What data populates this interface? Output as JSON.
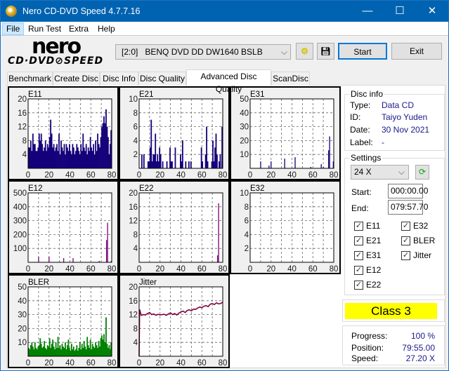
{
  "window": {
    "title": "Nero CD-DVD Speed 4.7.7.16",
    "minimize": "—",
    "maximize": "☐",
    "close": "✕"
  },
  "menu": [
    "File",
    "Run Test",
    "Extra",
    "Help"
  ],
  "logo": {
    "top": "nero",
    "bottom": "CD·DVD⊘SPEED"
  },
  "toolbar": {
    "drive": "[2:0]   BENQ DVD DD DW1640 BSLB",
    "start": "Start",
    "exit": "Exit"
  },
  "tabs": [
    "Benchmark",
    "Create Disc",
    "Disc Info",
    "Disc Quality",
    "Advanced Disc Quality",
    "ScanDisc"
  ],
  "active_tab": "Advanced Disc Quality",
  "disc_info": {
    "title": "Disc info",
    "type_label": "Type:",
    "type": "Data CD",
    "id_label": "ID:",
    "id": "Taiyo Yuden",
    "date_label": "Date:",
    "date": "30 Nov 2021",
    "label_label": "Label:",
    "label": "-"
  },
  "settings": {
    "title": "Settings",
    "speed": "24 X",
    "start_label": "Start:",
    "start": "000:00.00",
    "end_label": "End:",
    "end": "079:57.70",
    "checks": [
      {
        "label": "E11",
        "checked": true
      },
      {
        "label": "E32",
        "checked": true
      },
      {
        "label": "E21",
        "checked": true
      },
      {
        "label": "BLER",
        "checked": true
      },
      {
        "label": "E31",
        "checked": true
      },
      {
        "label": "Jitter",
        "checked": true
      },
      {
        "label": "E12",
        "checked": true
      },
      {
        "label": "E22",
        "checked": true
      }
    ]
  },
  "result": {
    "class": "Class 3",
    "color": "#ffff00"
  },
  "status": {
    "progress_label": "Progress:",
    "progress": "100 %",
    "position_label": "Position:",
    "position": "79:55.00",
    "speed_label": "Speed:",
    "speed": "27.20 X"
  },
  "chart_data": [
    {
      "title": "E11",
      "type": "bar",
      "color": "#14007a",
      "xlim": [
        0,
        80
      ],
      "ylim": [
        0,
        20
      ],
      "yticks": [
        4,
        8,
        12,
        16,
        20
      ],
      "xticks": [
        0,
        20,
        40,
        60,
        80
      ],
      "grid": true,
      "values": [
        6,
        6,
        8,
        5,
        10,
        7,
        7,
        5,
        5,
        6,
        10,
        8,
        10,
        7,
        5,
        6,
        8,
        5,
        7,
        6,
        9,
        14,
        10,
        6,
        7,
        5,
        6,
        7,
        5,
        10,
        4,
        8,
        6,
        5,
        7,
        4,
        7,
        6,
        5,
        7,
        5,
        4,
        7,
        6,
        4,
        5,
        7,
        6,
        5,
        4,
        7,
        5,
        10,
        6,
        5,
        7,
        4,
        6,
        5,
        9,
        6,
        5,
        7,
        4,
        8,
        5,
        10,
        7,
        6,
        9,
        12,
        13,
        15,
        13,
        17,
        12,
        9,
        4,
        7,
        6,
        11
      ]
    },
    {
      "title": "E21",
      "type": "bar",
      "color": "#14007a",
      "xlim": [
        0,
        80
      ],
      "ylim": [
        0,
        10
      ],
      "yticks": [
        2,
        4,
        6,
        8,
        10
      ],
      "xticks": [
        0,
        20,
        40,
        60,
        80
      ],
      "grid": true,
      "values": [
        0,
        0,
        2,
        0,
        2,
        0,
        0,
        0,
        1,
        1,
        3,
        7,
        1,
        2,
        2,
        5,
        1,
        2,
        1,
        3,
        2,
        0,
        1,
        0,
        0,
        0,
        1,
        0,
        0,
        3,
        1,
        1,
        0,
        0,
        3,
        0,
        0,
        0,
        0,
        2,
        1,
        4,
        0,
        0,
        1,
        0,
        0,
        1,
        0,
        1,
        0,
        0,
        0,
        0,
        0,
        0,
        0,
        0,
        0,
        3,
        1,
        0,
        0,
        2,
        6,
        1,
        0,
        0,
        0,
        1,
        4,
        1,
        3,
        5,
        2,
        0,
        1,
        2,
        0,
        1,
        6
      ]
    },
    {
      "title": "E31",
      "type": "bar",
      "color": "#14007a",
      "xlim": [
        0,
        80
      ],
      "ylim": [
        0,
        50
      ],
      "yticks": [
        10,
        20,
        30,
        40,
        50
      ],
      "xticks": [
        0,
        20,
        40,
        60,
        80
      ],
      "grid": true,
      "points": [
        [
          10,
          5
        ],
        [
          18,
          2
        ],
        [
          20,
          5
        ],
        [
          33,
          7
        ],
        [
          43,
          8
        ],
        [
          58,
          1
        ],
        [
          68,
          3
        ],
        [
          70,
          1
        ],
        [
          75,
          13
        ],
        [
          76,
          23
        ],
        [
          80,
          5
        ]
      ]
    },
    {
      "title": "E12",
      "type": "bar",
      "color": "#7a007a",
      "xlim": [
        0,
        80
      ],
      "ylim": [
        0,
        500
      ],
      "yticks": [
        100,
        200,
        300,
        400,
        500
      ],
      "xticks": [
        0,
        20,
        40,
        60,
        80
      ],
      "grid": true,
      "points": [
        [
          10,
          40
        ],
        [
          20,
          40
        ],
        [
          34,
          30
        ],
        [
          43,
          30
        ],
        [
          68,
          10
        ],
        [
          75,
          160
        ],
        [
          76,
          285
        ],
        [
          80,
          10
        ]
      ]
    },
    {
      "title": "E22",
      "type": "bar",
      "color": "#7a007a",
      "xlim": [
        0,
        80
      ],
      "ylim": [
        0,
        20
      ],
      "yticks": [
        4,
        8,
        12,
        16,
        20
      ],
      "xticks": [
        0,
        20,
        40,
        60,
        80
      ],
      "grid": true,
      "points": [
        [
          75,
          2
        ],
        [
          76,
          17
        ]
      ]
    },
    {
      "title": "E32",
      "type": "bar",
      "color": "#7a007a",
      "xlim": [
        0,
        80
      ],
      "ylim": [
        0,
        10
      ],
      "yticks": [
        2,
        4,
        6,
        8,
        10
      ],
      "xticks": [
        0,
        20,
        40,
        60,
        80
      ],
      "grid": true,
      "points": []
    },
    {
      "title": "BLER",
      "type": "bar",
      "color": "#008000",
      "xlim": [
        0,
        80
      ],
      "ylim": [
        0,
        50
      ],
      "yticks": [
        10,
        20,
        30,
        40,
        50
      ],
      "xticks": [
        0,
        20,
        40,
        60,
        80
      ],
      "grid": true,
      "values": [
        6,
        5,
        8,
        10,
        7,
        5,
        10,
        6,
        5,
        7,
        8,
        13,
        9,
        6,
        7,
        11,
        6,
        5,
        8,
        7,
        13,
        6,
        9,
        12,
        7,
        5,
        10,
        6,
        14,
        6,
        8,
        5,
        9,
        7,
        6,
        10,
        5,
        8,
        12,
        6,
        4,
        9,
        5,
        7,
        4,
        5,
        8,
        4,
        6,
        10,
        5,
        9,
        6,
        11,
        7,
        5,
        14,
        8,
        6,
        12,
        5,
        9,
        7,
        6,
        10,
        8,
        6,
        11,
        7,
        13,
        15,
        12,
        16,
        10,
        28,
        9,
        6,
        8,
        5,
        6,
        10
      ]
    },
    {
      "title": "Jitter",
      "type": "line",
      "color": "#800040",
      "xlim": [
        0,
        80
      ],
      "ylim": [
        0,
        20
      ],
      "yticks": [
        4,
        8,
        12,
        16,
        20
      ],
      "xticks": [
        0,
        20,
        40,
        60,
        80
      ],
      "grid": true,
      "x": [
        0,
        0.5,
        2,
        4,
        6,
        8,
        10,
        12,
        14,
        16,
        18,
        20,
        22,
        24,
        26,
        28,
        30,
        32,
        34,
        36,
        38,
        40,
        42,
        44,
        46,
        48,
        50,
        52,
        54,
        56,
        58,
        60,
        62,
        64,
        66,
        68,
        70,
        72,
        74,
        76,
        78,
        80
      ],
      "y": [
        0,
        13.5,
        11.8,
        12,
        11.9,
        12.3,
        12.6,
        12,
        12.2,
        11.8,
        12.1,
        11.9,
        12,
        12.1,
        11.8,
        12.2,
        12.5,
        12,
        12.3,
        11.9,
        12.4,
        12.8,
        13,
        12.6,
        13.2,
        13.4,
        13.1,
        13.6,
        13.5,
        13.9,
        14.2,
        14,
        14.4,
        14.6,
        14.3,
        15,
        15.2,
        14.9,
        15.4,
        15.1,
        15.2,
        15.6
      ]
    }
  ]
}
